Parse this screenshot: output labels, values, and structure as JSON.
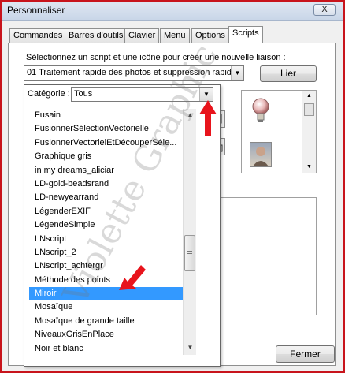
{
  "window": {
    "title": "Personnaliser",
    "close_label": "X"
  },
  "tabs": [
    {
      "label": "Commandes",
      "active": false
    },
    {
      "label": "Barres d'outils",
      "active": false
    },
    {
      "label": "Clavier",
      "active": false
    },
    {
      "label": "Menu",
      "active": false
    },
    {
      "label": "Options",
      "active": false
    },
    {
      "label": "Scripts",
      "active": true
    }
  ],
  "scripts": {
    "instruction": "Sélectionnez un script et une icône pour créer une nouvelle liaison :",
    "selected_script": "01 Traitement rapide des photos et suppression rapid...",
    "link_button": "Lier",
    "category_label": "Catégorie :",
    "category_value": "Tous",
    "items": [
      "Fusain",
      "FusionnerSélectionVectorielle",
      "FusionnerVectorielEtDécouperSéle...",
      "Graphique gris",
      "in my dreams_aliciar",
      "LD-gold-beadsrand",
      "LD-newyearrand",
      "LégenderEXIF",
      "LégendeSimple",
      "LNscript",
      "LNscript_2",
      "LNscript_achtergr",
      "Méthode des points",
      "Miroir",
      "Mosaïque",
      "Mosaïque de grande taille",
      "NiveauxGrisEnPlace",
      "Noir et blanc"
    ],
    "selected_item": "Miroir"
  },
  "footer": {
    "close_button": "Fermer"
  },
  "watermark": "Violette Graphic",
  "colors": {
    "selection": "#3399ff",
    "arrow": "#e8141c",
    "frame": "#c8141c"
  }
}
